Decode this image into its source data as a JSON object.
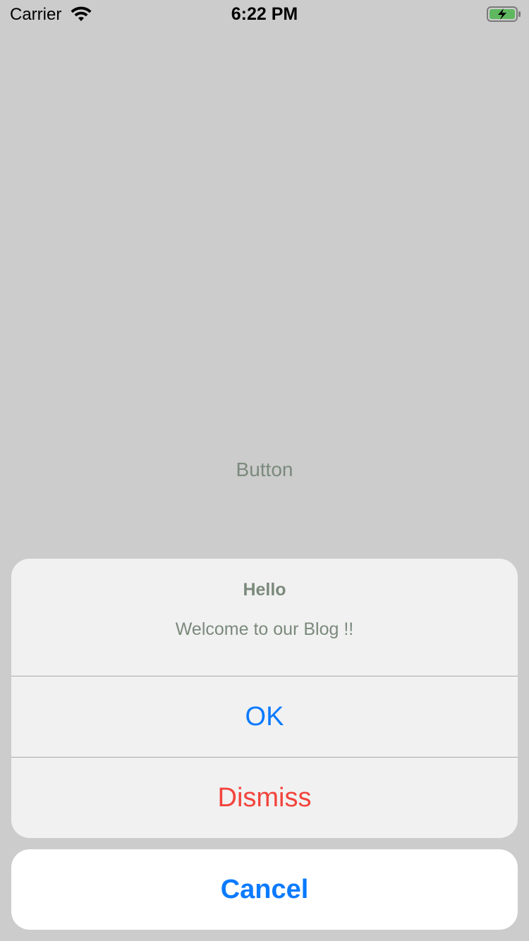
{
  "status_bar": {
    "carrier": "Carrier",
    "time": "6:22 PM",
    "wifi_icon": "wifi-icon",
    "battery_icon": "battery-charging-icon",
    "battery_color": "#5fb85f"
  },
  "background": {
    "button_label": "Button",
    "color": "#cccccc"
  },
  "action_sheet": {
    "title": "Hello",
    "message": "Welcome to our Blog !!",
    "actions": [
      {
        "label": "OK",
        "color": "#0a7aff"
      },
      {
        "label": "Dismiss",
        "color": "#f2443c"
      }
    ],
    "cancel_label": "Cancel"
  }
}
